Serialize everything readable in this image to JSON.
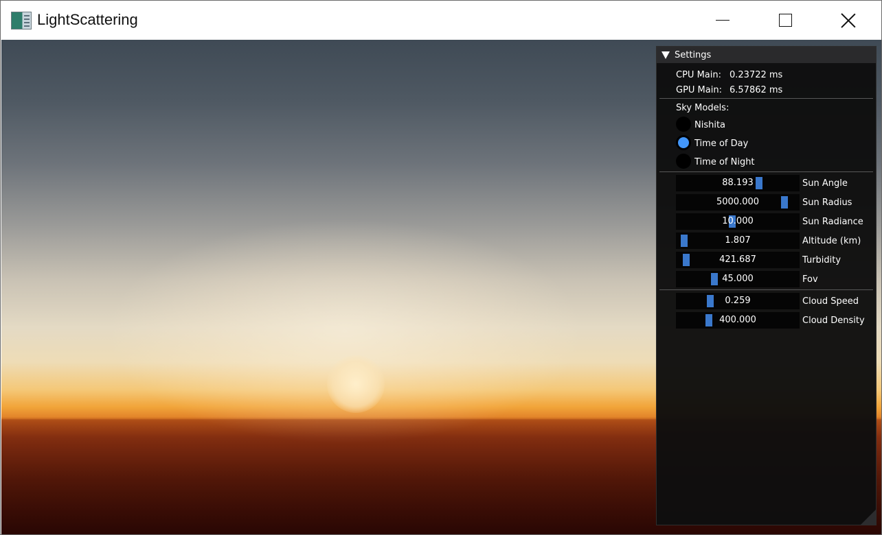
{
  "window": {
    "title": "LightScattering"
  },
  "settings": {
    "header": "Settings",
    "stats": [
      {
        "label": "CPU Main:",
        "value": "0.23722 ms"
      },
      {
        "label": "GPU Main:",
        "value": "6.57862 ms"
      }
    ],
    "sky_models": {
      "label": "Sky Models:",
      "options": [
        "Nishita",
        "Time of Day",
        "Time of Night"
      ],
      "selected": "Time of Day"
    },
    "sliders": [
      {
        "label": "Sun Angle",
        "value": "88.193",
        "fraction": 0.69
      },
      {
        "label": "Sun Radius",
        "value": "5000.000",
        "fraction": 0.92
      },
      {
        "label": "Sun Radiance",
        "value": "10.000",
        "fraction": 0.45
      },
      {
        "label": "Altitude (km)",
        "value": "1.807",
        "fraction": 0.02
      },
      {
        "label": "Turbidity",
        "value": "421.687",
        "fraction": 0.04
      },
      {
        "label": "Fov",
        "value": "45.000",
        "fraction": 0.29
      }
    ],
    "cloud_sliders": [
      {
        "label": "Cloud Speed",
        "value": "0.259",
        "fraction": 0.25
      },
      {
        "label": "Cloud Density",
        "value": "400.000",
        "fraction": 0.24
      }
    ]
  },
  "colors": {
    "accent": "#4296fa",
    "grab": "#3a78cc",
    "panel_bg": "#0e0e0e"
  }
}
